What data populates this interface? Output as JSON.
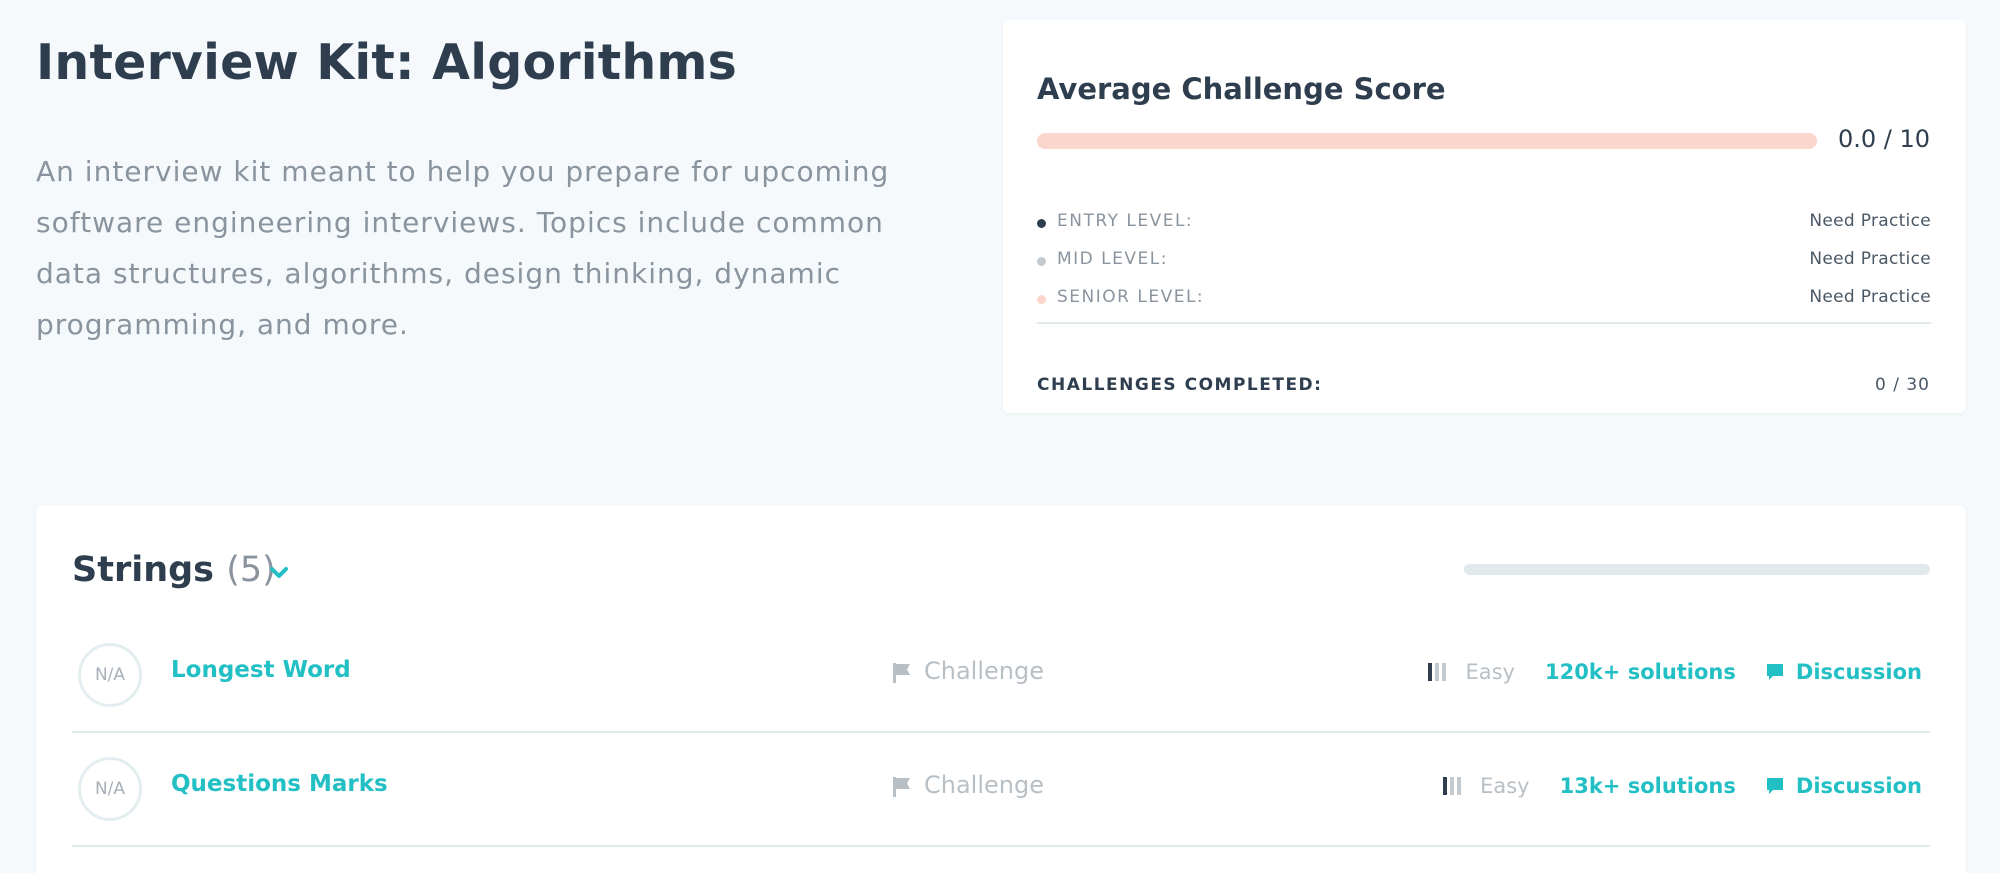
{
  "kit": {
    "title": "Interview Kit: Algorithms",
    "description": "An interview kit meant to help you prepare for upcoming software engineering interviews. Topics include common data structures, algorithms, design thinking, dynamic programming, and more."
  },
  "score_card": {
    "title": "Average Challenge Score",
    "score_display": "0.0 / 10",
    "score_fraction": 0.0,
    "levels": [
      {
        "label": "ENTRY LEVEL:",
        "status": "Need Practice",
        "dot_color": "#2f3e4f"
      },
      {
        "label": "MID LEVEL:",
        "status": "Need Practice",
        "dot_color": "#c4cbd0"
      },
      {
        "label": "SENIOR LEVEL:",
        "status": "Need Practice",
        "dot_color": "#fbd6cc"
      }
    ],
    "completed_label": "CHALLENGES COMPLETED:",
    "completed_value": "0 / 30"
  },
  "section": {
    "title": "Strings",
    "count": "(5)",
    "progress_fraction": 0.0,
    "chevron_icon": "chevron-down-icon",
    "challenges": [
      {
        "badge": "N/A",
        "name": "Longest Word",
        "type_icon": "flag-icon",
        "type": "Challenge",
        "difficulty_icon": "difficulty-bars-icon",
        "difficulty": "Easy",
        "solutions": "120k+ solutions",
        "discussion_icon": "chat-icon",
        "discussion": "Discussion"
      },
      {
        "badge": "N/A",
        "name": "Questions Marks",
        "type_icon": "flag-icon",
        "type": "Challenge",
        "difficulty_icon": "difficulty-bars-icon",
        "difficulty": "Easy",
        "solutions": "13k+ solutions",
        "discussion_icon": "chat-icon",
        "discussion": "Discussion"
      }
    ]
  },
  "colors": {
    "accent": "#22bfc4",
    "score_bar_track": "#fbd6cc",
    "heading": "#2f3e4f",
    "muted": "#8a949e"
  }
}
